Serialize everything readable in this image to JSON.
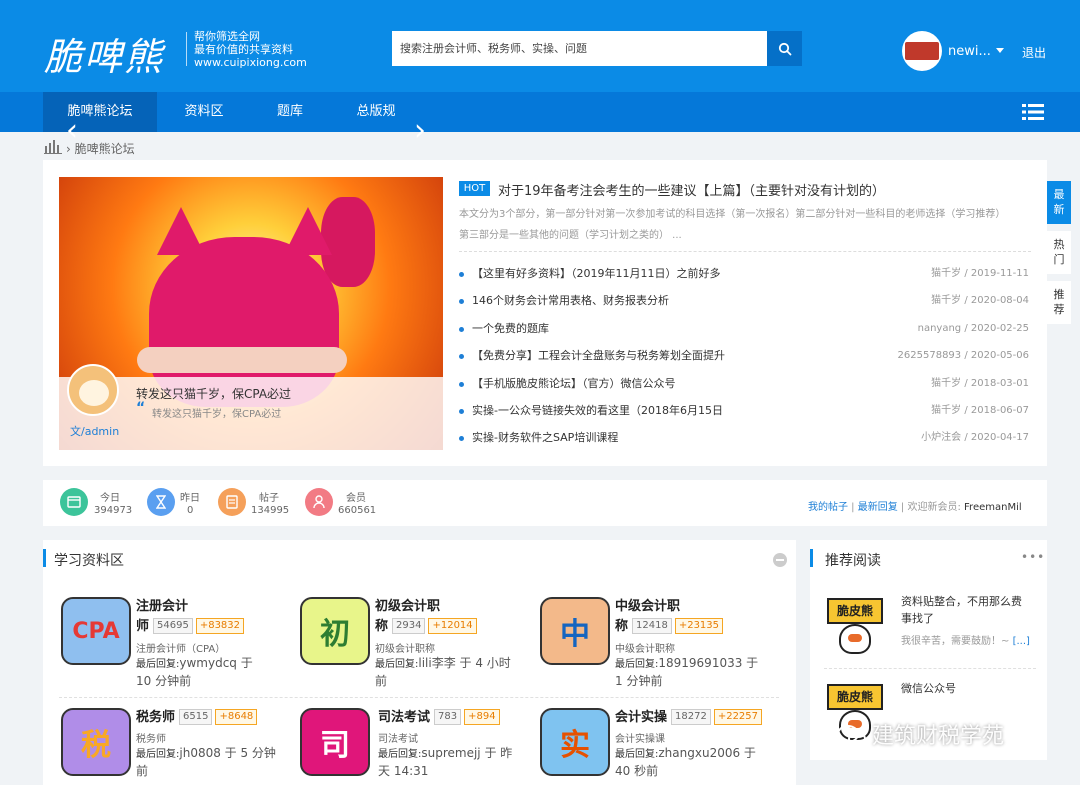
{
  "header": {
    "logo": "脆啤熊",
    "slogan": [
      "帮你筛选全网",
      "最有价值的共享资料",
      "www.cuipixiong.com"
    ],
    "search_placeholder": "搜索注册会计师、税务师、实操、问题",
    "username": "newi...",
    "logout": "退出"
  },
  "nav": {
    "items": [
      "脆啤熊论坛",
      "资料区",
      "题库",
      "总版规"
    ]
  },
  "breadcrumb": "脆啤熊论坛",
  "slider": {
    "caption_title": "转发这只猫千岁，保CPA必过",
    "caption_quote": "转发这只猫千岁，保CPA必过",
    "author": "文/admin"
  },
  "hot": {
    "badge": "HOT",
    "title": "对于19年备考注会考生的一些建议【上篇】（主要针对没有计划的）",
    "summary_line1": "本文分为3个部分，第一部分针对第一次参加考试的科目选择（第一次报名）第二部分针对一些科目的老师选择（学习推荐）",
    "summary_line2": "第三部分是一些其他的问题（学习计划之类的） ..."
  },
  "posts": [
    {
      "title": "【这里有好多资料】（2019年11月11日）之前好多",
      "meta": "猫千岁 / 2019-11-11"
    },
    {
      "title": "146个财务会计常用表格、财务报表分析",
      "meta": "猫千岁 / 2020-08-04"
    },
    {
      "title": "一个免费的题库",
      "meta": "nanyang / 2020-02-25"
    },
    {
      "title": "【免费分享】工程会计全盘账务与税务筹划全面提升",
      "meta": "2625578893 / 2020-05-06"
    },
    {
      "title": "【手机版脆皮熊论坛】（官方）微信公众号",
      "meta": "猫千岁 / 2018-03-01"
    },
    {
      "title": "实操-一公众号链接失效的看这里（2018年6月15日",
      "meta": "猫千岁 / 2018-06-07"
    },
    {
      "title": "实操-财务软件之SAP培训课程",
      "meta": "小炉注会 / 2020-04-17"
    }
  ],
  "side_tabs": [
    {
      "line1": "最",
      "line2": "新"
    },
    {
      "line1": "热",
      "line2": "门"
    },
    {
      "line1": "推",
      "line2": "荐"
    }
  ],
  "stats": [
    {
      "label": "今日",
      "value": "394973",
      "color": "#3cc49a"
    },
    {
      "label": "昨日",
      "value": "0",
      "color": "#5a9ff0"
    },
    {
      "label": "帖子",
      "value": "134995",
      "color": "#f5a05a"
    },
    {
      "label": "会员",
      "value": "660561",
      "color": "#f27b84"
    }
  ],
  "stats_links": {
    "my_posts": "我的帖子",
    "latest_reply": "最新回复",
    "welcome": "欢迎新会员:",
    "new_member": "FreemanMil"
  },
  "study_zone": {
    "title": "学习资料区",
    "forums": [
      {
        "icon": "CPA",
        "name1": "注册会计",
        "name2": "师",
        "count": "54695",
        "new": "+83832",
        "sub": "注册会计师（CPA）",
        "last_label": "最后回复:",
        "last1": "ywmydcq 于",
        "last2": "10 分钟前",
        "bg": "#8fbfef",
        "fg": "#e53935"
      },
      {
        "icon": "初",
        "name1": "初级会计职",
        "name2": "称",
        "count": "2934",
        "new": "+12014",
        "sub": "初级会计职称",
        "last_label": "最后回复:",
        "last1": "lili李李 于 4 小时",
        "last2": "前",
        "bg": "#e8f58a",
        "fg": "#2e7d32"
      },
      {
        "icon": "中",
        "name1": "中级会计职",
        "name2": "称",
        "count": "12418",
        "new": "+23135",
        "sub": "中级会计职称",
        "last_label": "最后回复:",
        "last1": "18919691033 于",
        "last2": "1 分钟前",
        "bg": "#f3b98a",
        "fg": "#1565c0"
      },
      {
        "icon": "税",
        "name1": "税务师",
        "name2": "",
        "count": "6515",
        "new": "+8648",
        "sub": "税务师",
        "last_label": "最后回复:",
        "last1": "jh0808 于 5 分钟",
        "last2": "前",
        "bg": "#b08de8",
        "fg": "#f9a825"
      },
      {
        "icon": "司",
        "name1": "司法考试",
        "name2": "",
        "count": "783",
        "new": "+894",
        "sub": "司法考试",
        "last_label": "最后回复:",
        "last1": "supremejj 于 昨",
        "last2": "天 14:31",
        "bg": "#e0167a",
        "fg": "#ffffff"
      },
      {
        "icon": "实",
        "name1": "会计实操",
        "name2": "",
        "count": "18272",
        "new": "+22257",
        "sub": "会计实操课",
        "last_label": "最后回复:",
        "last1": "zhangxu2006 于",
        "last2": "40 秒前",
        "bg": "#7fc3f0",
        "fg": "#e65100"
      }
    ]
  },
  "recommend": {
    "title": "推荐阅读",
    "more": "•••",
    "items": [
      {
        "thumb": "脆皮熊",
        "title1": "资料贴整合，不用那么费",
        "title2": "事找了",
        "desc": "我很辛苦，需要鼓励！~",
        "more": "[...]"
      },
      {
        "thumb": "脆皮熊",
        "title1": "微信公众号",
        "title2": "",
        "desc": "",
        "more": ""
      }
    ]
  },
  "watermark": "建筑财税学苑"
}
